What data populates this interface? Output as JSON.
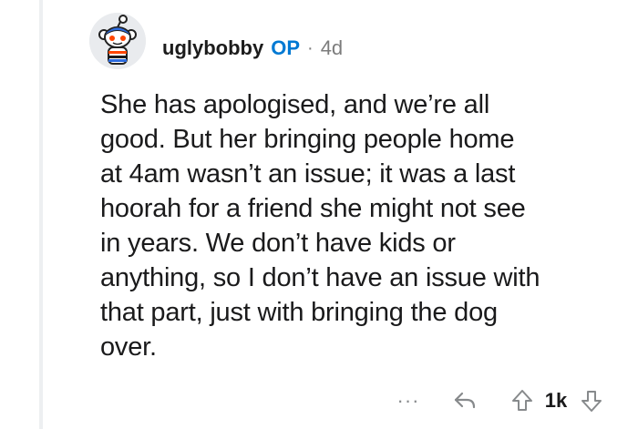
{
  "comment": {
    "username": "uglybobby",
    "badge": "OP",
    "separator": "·",
    "age": "4d",
    "body": "She has apologised, and we’re all\ngood. But her bringing people home\nat 4am wasn’t an issue; it was a last\nhoorah for a friend she might not see\nin years. We don’t have kids or\nanything, so I don’t have an issue with\nthat part, just with bringing the dog\nover."
  },
  "actions": {
    "more_label": "···",
    "score": "1k"
  },
  "colors": {
    "op_badge": "#0079d3",
    "meta_gray": "#7c7c7c",
    "text": "#1a1a1b",
    "thread_line": "#edeff1"
  },
  "icons": {
    "avatar": "snoo-avatar",
    "reply": "reply-arrow-icon",
    "upvote": "upvote-arrow-icon",
    "downvote": "downvote-arrow-icon",
    "more": "more-options-icon"
  }
}
